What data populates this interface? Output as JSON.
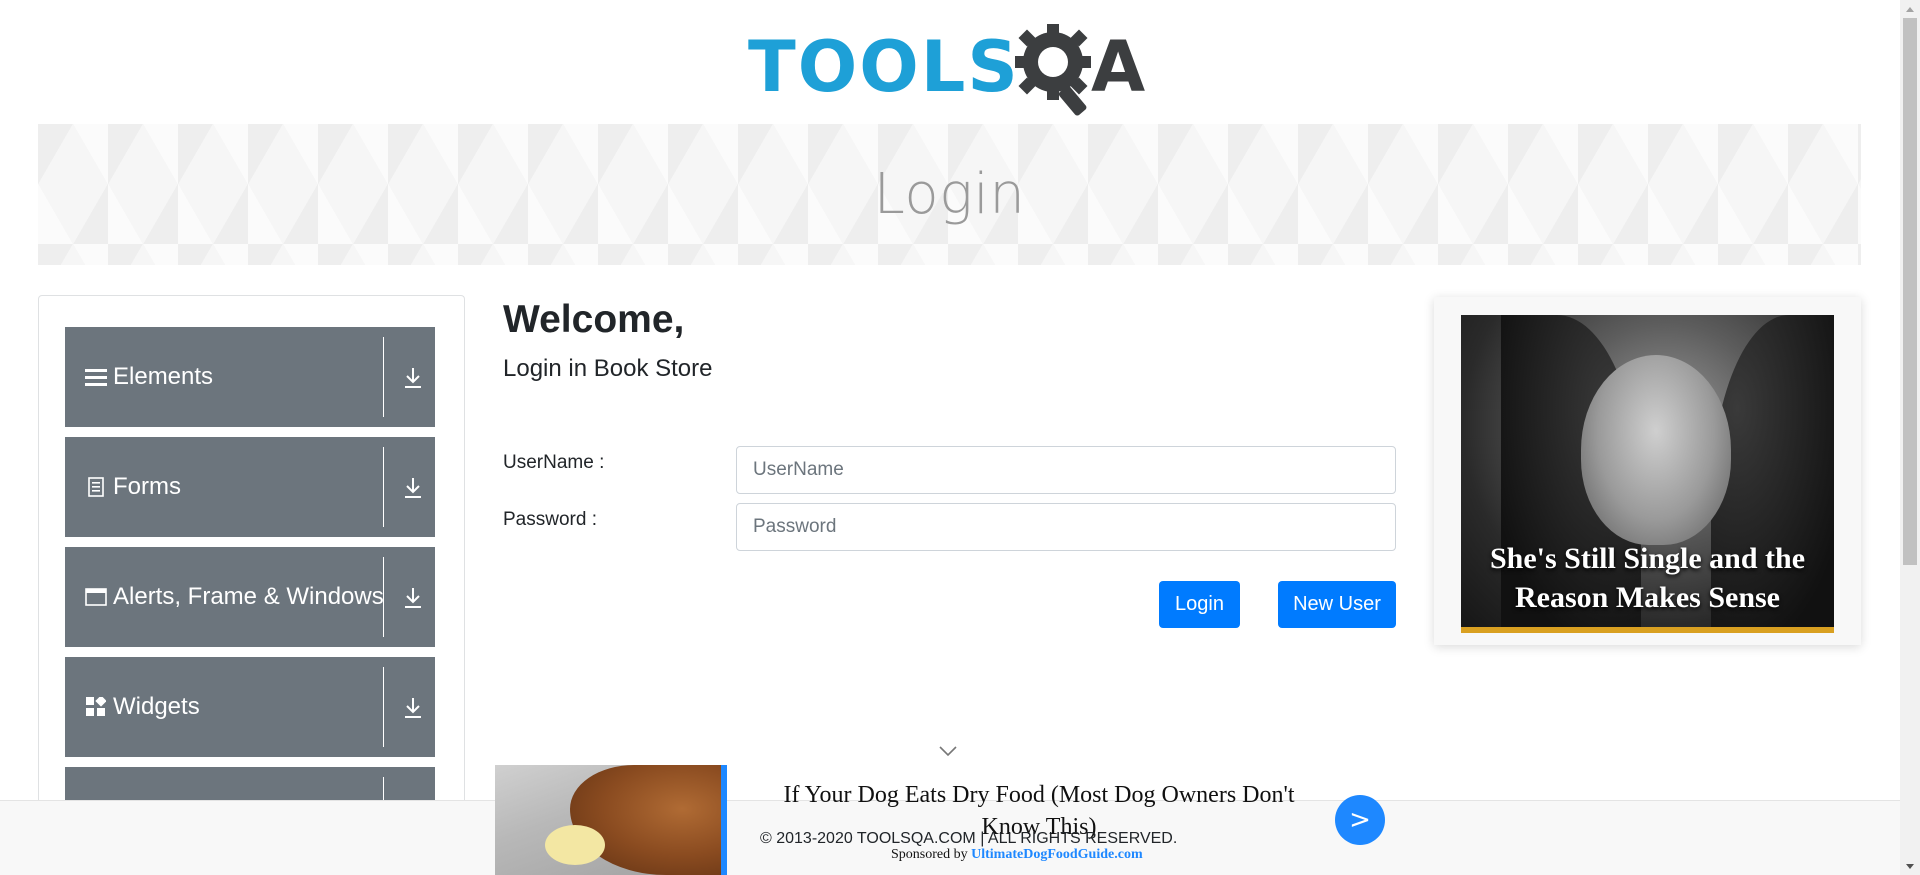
{
  "logo": {
    "text_tools": "TOOLS",
    "text_a": "A",
    "tools_color": "#1ea0d7",
    "a_color": "#3c3e40"
  },
  "banner": {
    "title": "Login"
  },
  "sidebar": {
    "items": [
      {
        "label": "Elements",
        "icon": "hamburger-icon"
      },
      {
        "label": "Forms",
        "icon": "document-icon"
      },
      {
        "label": "Alerts, Frame & Windows",
        "icon": "window-icon"
      },
      {
        "label": "Widgets",
        "icon": "widgets-icon"
      },
      {
        "label": "",
        "icon": ""
      }
    ],
    "item_bg": "#6c757d"
  },
  "main": {
    "welcome": "Welcome,",
    "subtitle": "Login in Book Store",
    "username_label": "UserName :",
    "username_placeholder": "UserName",
    "username_value": "",
    "password_label": "Password :",
    "password_placeholder": "Password",
    "password_value": "",
    "login_button": "Login",
    "new_user_button": "New User",
    "accent": "#007bff"
  },
  "right_ad": {
    "caption": "She's Still Single and the Reason Makes Sense"
  },
  "bottom_ad": {
    "title": "If Your Dog Eats Dry Food (Most Dog Owners Don't Know This)",
    "sponsored_by": "Sponsored by",
    "sponsor": "UltimateDogFoodGuide.com",
    "go_label": ">"
  },
  "footer": {
    "copyright": "© 2013-2020 TOOLSQA.COM | ALL RIGHTS RESERVED."
  }
}
